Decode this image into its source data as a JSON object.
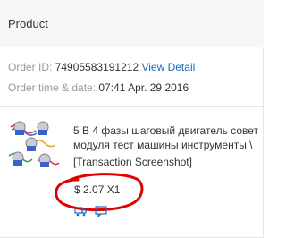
{
  "header": {
    "title": "Product"
  },
  "order": {
    "id_label": "Order ID: ",
    "id_value": "74905583191212",
    "view_detail": "View Detail",
    "time_label": "Order time & date: ",
    "time_value": "07:41 Apr. 29 2016"
  },
  "item": {
    "title_line1": "5 В 4 фазы шаговый двигатель совет",
    "title_line2": "модуля тест машины инструменты \\",
    "snapshot": "[Transaction Screenshot]",
    "price": "$ 2.07 X1"
  },
  "colors": {
    "link": "#1a6bc2",
    "annotation": "#e00000"
  },
  "icons": [
    "stepper-motor-thumbnail",
    "shipping-icon",
    "message-icon"
  ]
}
